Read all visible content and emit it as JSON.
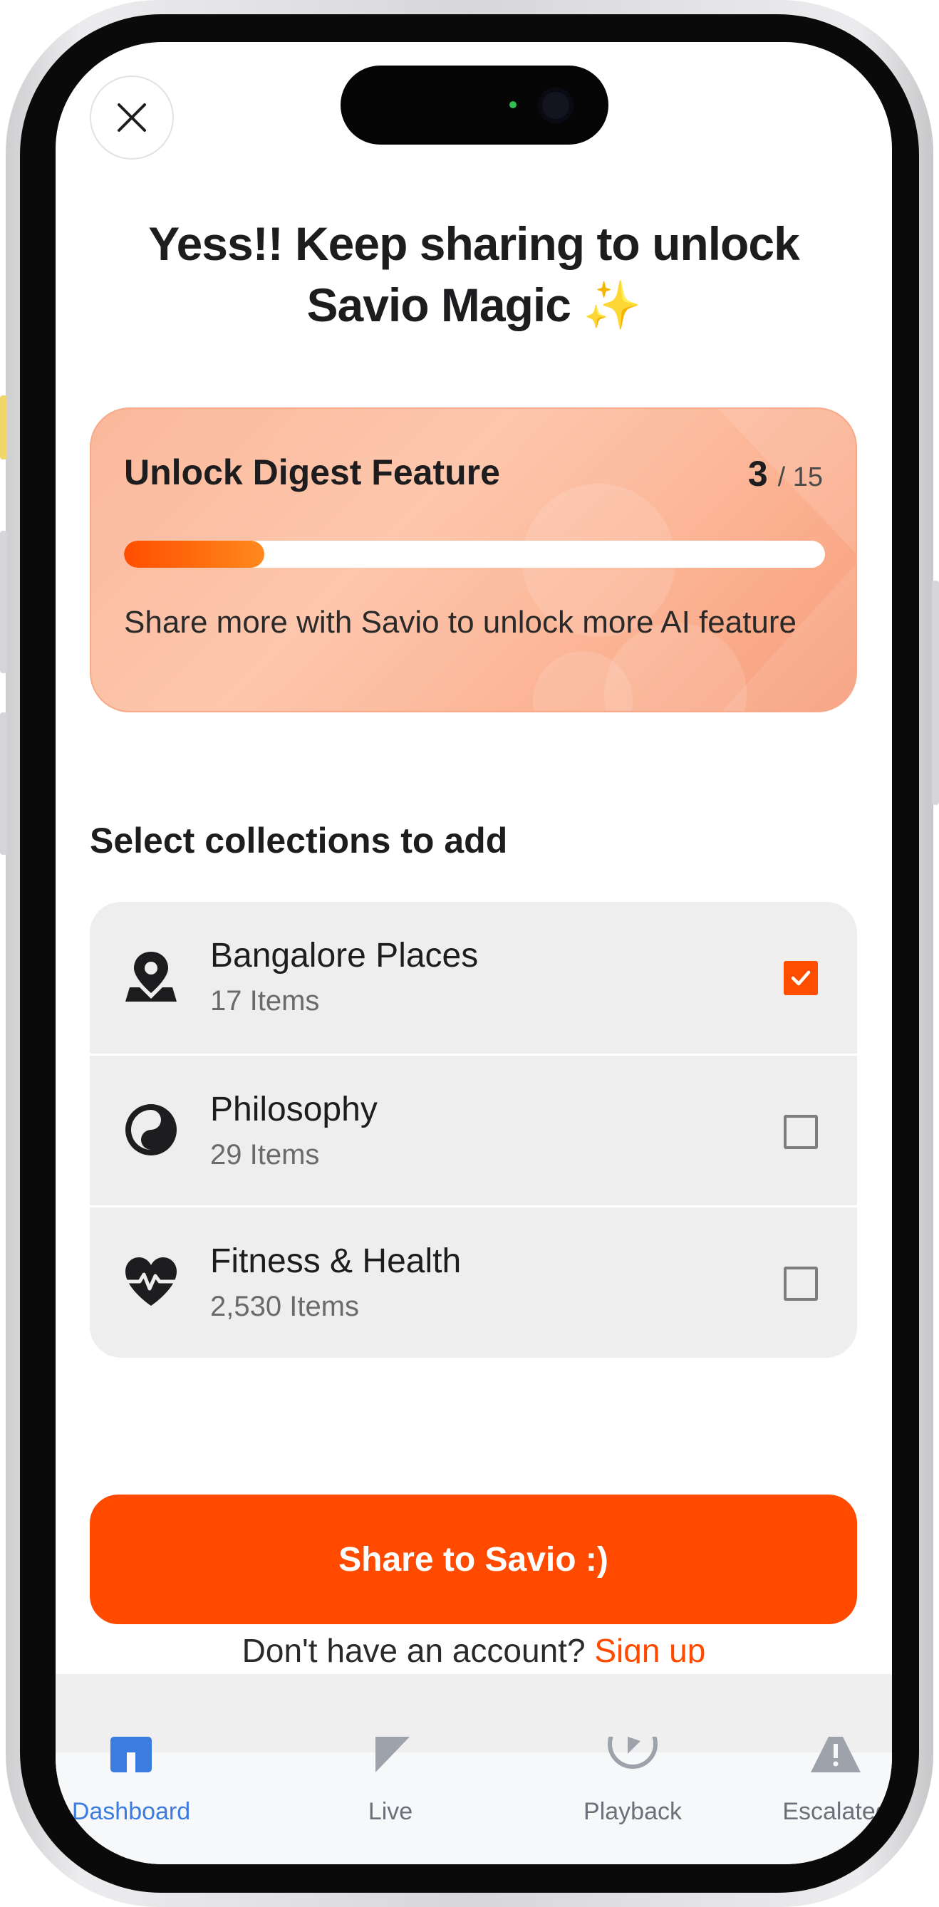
{
  "header": {
    "title_line1": "Yess!! Keep sharing to unlock",
    "title_line2": "Savio Magic ✨"
  },
  "unlock_card": {
    "title": "Unlock Digest Feature",
    "current": "3",
    "total": "/ 15",
    "progress_fraction": 0.2,
    "subtitle": "Share more with Savio to unlock more AI feature"
  },
  "collections": {
    "section_title": "Select collections to add",
    "items": [
      {
        "name": "Bangalore Places",
        "count": "17 Items",
        "icon": "map-pin-icon",
        "checked": true
      },
      {
        "name": "Philosophy",
        "count": "29 Items",
        "icon": "yin-yang-icon",
        "checked": false
      },
      {
        "name": "Fitness & Health",
        "count": "2,530 Items",
        "icon": "heart-pulse-icon",
        "checked": false
      }
    ]
  },
  "share_button": {
    "label": "Share to Savio :)"
  },
  "signup": {
    "prompt": "Don't have an account?",
    "link": "Sign up"
  },
  "tab_bar": {
    "tabs": [
      {
        "label": "Dashboard",
        "icon": "home-icon",
        "active": true
      },
      {
        "label": "Live",
        "icon": "play-icon",
        "active": false
      },
      {
        "label": "Playback",
        "icon": "playback-icon",
        "active": false
      },
      {
        "label": "Escalated",
        "icon": "warning-icon",
        "active": false
      }
    ]
  },
  "colors": {
    "accent": "#ff4a00",
    "active_tab": "#3b7ce0",
    "card_bg": "#fcbfa3"
  }
}
